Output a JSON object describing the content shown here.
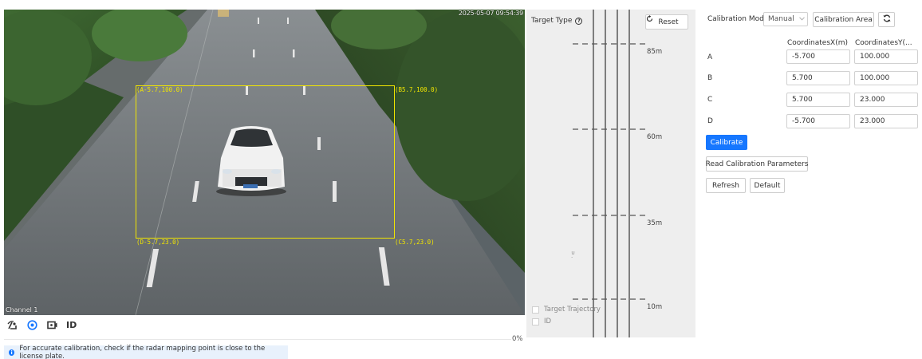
{
  "video": {
    "timestamp": "2025-05-07 09:54:39",
    "channel_label": "Channel 1",
    "corners": {
      "a": "(A-5.7,100.0)",
      "b": "(B5.7,100.0)",
      "c": "(C5.7,23.0)",
      "d": "(D-5.7,23.0)"
    },
    "box_color": "#f2e600"
  },
  "toolbar": {
    "icons": [
      "radar-icon",
      "target-icon",
      "record-icon"
    ],
    "id_label": "ID"
  },
  "progress": {
    "value_percent": 0,
    "label": "0%"
  },
  "notice": {
    "text": "For accurate calibration, check if the radar mapping point is close to the license plate."
  },
  "radar": {
    "target_type_label": "Target Type",
    "reset_label": "Reset",
    "distances": [
      "85m",
      "60m",
      "35m",
      "10m"
    ],
    "target_trajectory_label": "Target Trajectory",
    "id_label": "ID"
  },
  "settings": {
    "calibration_mode_label": "Calibration Mode",
    "mode_value": "Manual",
    "calibration_area_label": "Calibration Area",
    "col_x": "CoordinatesX(m)",
    "col_y": "CoordinatesY(...",
    "rows": [
      {
        "name": "A",
        "x": "-5.700",
        "y": "100.000"
      },
      {
        "name": "B",
        "x": "5.700",
        "y": "100.000"
      },
      {
        "name": "C",
        "x": "5.700",
        "y": "23.000"
      },
      {
        "name": "D",
        "x": "-5.700",
        "y": "23.000"
      }
    ],
    "calibrate_label": "Calibrate",
    "read_params_label": "Read Calibration Parameters",
    "refresh_label": "Refresh",
    "default_label": "Default"
  },
  "colors": {
    "accent": "#1677ff",
    "calibration_box": "#f2e600"
  }
}
